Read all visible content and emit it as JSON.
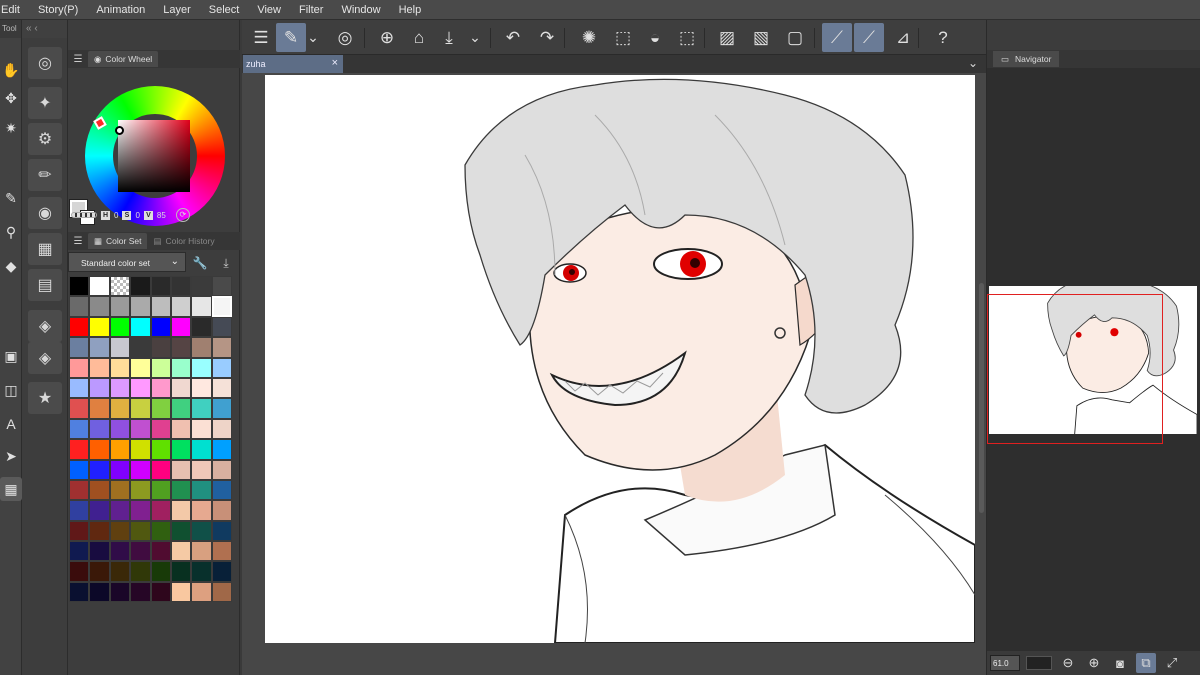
{
  "menu": [
    "Edit",
    "Story(P)",
    "Animation",
    "Layer",
    "Select",
    "View",
    "Filter",
    "Window",
    "Help"
  ],
  "left_tools": {
    "header": "Tool",
    "items": [
      {
        "name": "hand-icon",
        "glyph": "✋"
      },
      {
        "name": "move-icon",
        "glyph": "✥"
      },
      {
        "name": "sparkle-icon",
        "glyph": "✷"
      },
      {
        "name": "pen-icon",
        "glyph": "✎"
      },
      {
        "name": "stamp-icon",
        "glyph": "⚲"
      },
      {
        "name": "eraser-icon",
        "glyph": "◆"
      },
      {
        "name": "fill-icon",
        "glyph": "▣"
      },
      {
        "name": "frame-icon",
        "glyph": "◫"
      },
      {
        "name": "text-icon",
        "glyph": "A"
      },
      {
        "name": "operation-icon",
        "glyph": "➤"
      },
      {
        "name": "transparent-color-icon",
        "glyph": "▦"
      }
    ]
  },
  "sub_tools": [
    {
      "name": "lasso-icon",
      "glyph": "◎"
    },
    {
      "name": "brush-settings-icon",
      "glyph": "✦"
    },
    {
      "name": "gear-brush-icon",
      "glyph": "⚙"
    },
    {
      "name": "pencil-brush-icon",
      "glyph": "✏"
    },
    {
      "name": "color-wheel-panel-icon",
      "glyph": "◉"
    },
    {
      "name": "color-set-panel-icon",
      "glyph": "▦"
    },
    {
      "name": "film-panel-icon",
      "glyph": "▤"
    },
    {
      "name": "layer-property-icon",
      "glyph": "◈"
    },
    {
      "name": "layers-icon",
      "glyph": "◈"
    },
    {
      "name": "material-icon",
      "glyph": "★"
    }
  ],
  "color_wheel": {
    "tab_label": "Color Wheel",
    "h_label": "H",
    "h_value": "0",
    "s_label": "S",
    "s_value": "0",
    "v_label": "V",
    "v_value": "85",
    "main_color": "#d6d6d6"
  },
  "color_set": {
    "tab_label": "Color Set",
    "history_label": "Color History",
    "selected_set": "Standard color set",
    "palette": [
      "#000000",
      "#ffffff",
      "checker",
      "#1a1a1a",
      "#2a2a2a",
      "#333333",
      "#3b3b3b",
      "#4a4a4a",
      "#6a6a6a",
      "#8a8a8a",
      "#9a9a9a",
      "#aaaaaa",
      "#bdbdbd",
      "#cfcfcf",
      "#e6e6e6",
      "#f5f5f5",
      "#ff0000",
      "#ffff00",
      "#00ff00",
      "#00ffff",
      "#0000ff",
      "#ff00ff",
      "#2a2a2a",
      "#454a55",
      "#6b7fa0",
      "#8fa0c0",
      "#c8c8d0",
      "#3a3a3a",
      "#4a4040",
      "#554444",
      "#a08070",
      "#b59585",
      "#ff9999",
      "#ffbb99",
      "#ffdd99",
      "#ffff99",
      "#ccff99",
      "#99ffcc",
      "#99ffff",
      "#99ccff",
      "#99bbff",
      "#bb99ff",
      "#dd99ff",
      "#ff99ff",
      "#ff99cc",
      "#f0d8d0",
      "#ffe8e0",
      "#f5e1d8",
      "#e05050",
      "#e08040",
      "#e0b040",
      "#c8d040",
      "#80d040",
      "#40d080",
      "#40d0c0",
      "#40a0d0",
      "#5080e0",
      "#7060e0",
      "#9050e0",
      "#c050d0",
      "#e04090",
      "#f0c0b0",
      "#fbe0d4",
      "#eed4c8",
      "#ff2020",
      "#ff6000",
      "#ffa000",
      "#d0e000",
      "#60e000",
      "#00e060",
      "#00e0d0",
      "#00a0ff",
      "#0060ff",
      "#2020ff",
      "#8000ff",
      "#d000ff",
      "#ff0080",
      "#e6c0b0",
      "#f0c8b8",
      "#d8b0a0",
      "#a03030",
      "#a05020",
      "#a07020",
      "#8c9a20",
      "#50a020",
      "#209050",
      "#209080",
      "#2060a0",
      "#3040a0",
      "#402090",
      "#602090",
      "#802090",
      "#a02060",
      "#f3c9a8",
      "#e6a990",
      "#c89078",
      "#601818",
      "#602810",
      "#604010",
      "#505810",
      "#306010",
      "#105030",
      "#105048",
      "#103a60",
      "#101a50",
      "#180c40",
      "#300c48",
      "#400c40",
      "#500c30",
      "#f5caa5",
      "#d8a080",
      "#b07050",
      "#3a0c0c",
      "#3a1808",
      "#3a2808",
      "#303808",
      "#183a08",
      "#083020",
      "#08302c",
      "#082038",
      "#0a1030",
      "#0c0828",
      "#1a0628",
      "#260626",
      "#2e061c",
      "#f9c8a0",
      "#dda080",
      "#a06848"
    ]
  },
  "toolbar": {
    "buttons": [
      {
        "name": "menu-icon",
        "glyph": "☰",
        "on": false
      },
      {
        "name": "quick-access-icon",
        "glyph": "✎",
        "on": true
      },
      {
        "name": "chevron-down-icon",
        "glyph": "⌄",
        "on": false
      },
      {
        "name": "clip-studio-icon",
        "glyph": "◎",
        "on": false
      },
      {
        "name": "new-file-icon",
        "glyph": "⊕",
        "on": false
      },
      {
        "name": "open-folder-icon",
        "glyph": "⌂",
        "on": false
      },
      {
        "name": "save-icon",
        "glyph": "⤓",
        "on": false
      },
      {
        "name": "save-menu-chevron-icon",
        "glyph": "⌄",
        "on": false
      },
      {
        "name": "undo-icon",
        "glyph": "↶",
        "on": false
      },
      {
        "name": "redo-icon",
        "glyph": "↷",
        "on": false
      },
      {
        "name": "loading-icon",
        "glyph": "✺",
        "on": false
      },
      {
        "name": "selection-icon",
        "glyph": "⬚",
        "on": false
      },
      {
        "name": "fill-bucket-icon",
        "glyph": "◒",
        "on": false
      },
      {
        "name": "transform-icon",
        "glyph": "⬚",
        "on": false
      },
      {
        "name": "clear-outside-icon",
        "glyph": "▨",
        "on": false
      },
      {
        "name": "clear-inside-icon",
        "glyph": "▧",
        "on": false
      },
      {
        "name": "hide-selection-icon",
        "glyph": "▢",
        "on": false
      },
      {
        "name": "snap-line-icon",
        "glyph": "⟋",
        "on": true
      },
      {
        "name": "snap-brush-icon",
        "glyph": "⟋",
        "on": true
      },
      {
        "name": "ruler-icon",
        "glyph": "⊿",
        "on": false
      },
      {
        "name": "help-icon",
        "glyph": "?",
        "on": false
      }
    ]
  },
  "document": {
    "tab_title": "zuha"
  },
  "navigator": {
    "tab_label": "Navigator",
    "zoom": "61.0"
  }
}
